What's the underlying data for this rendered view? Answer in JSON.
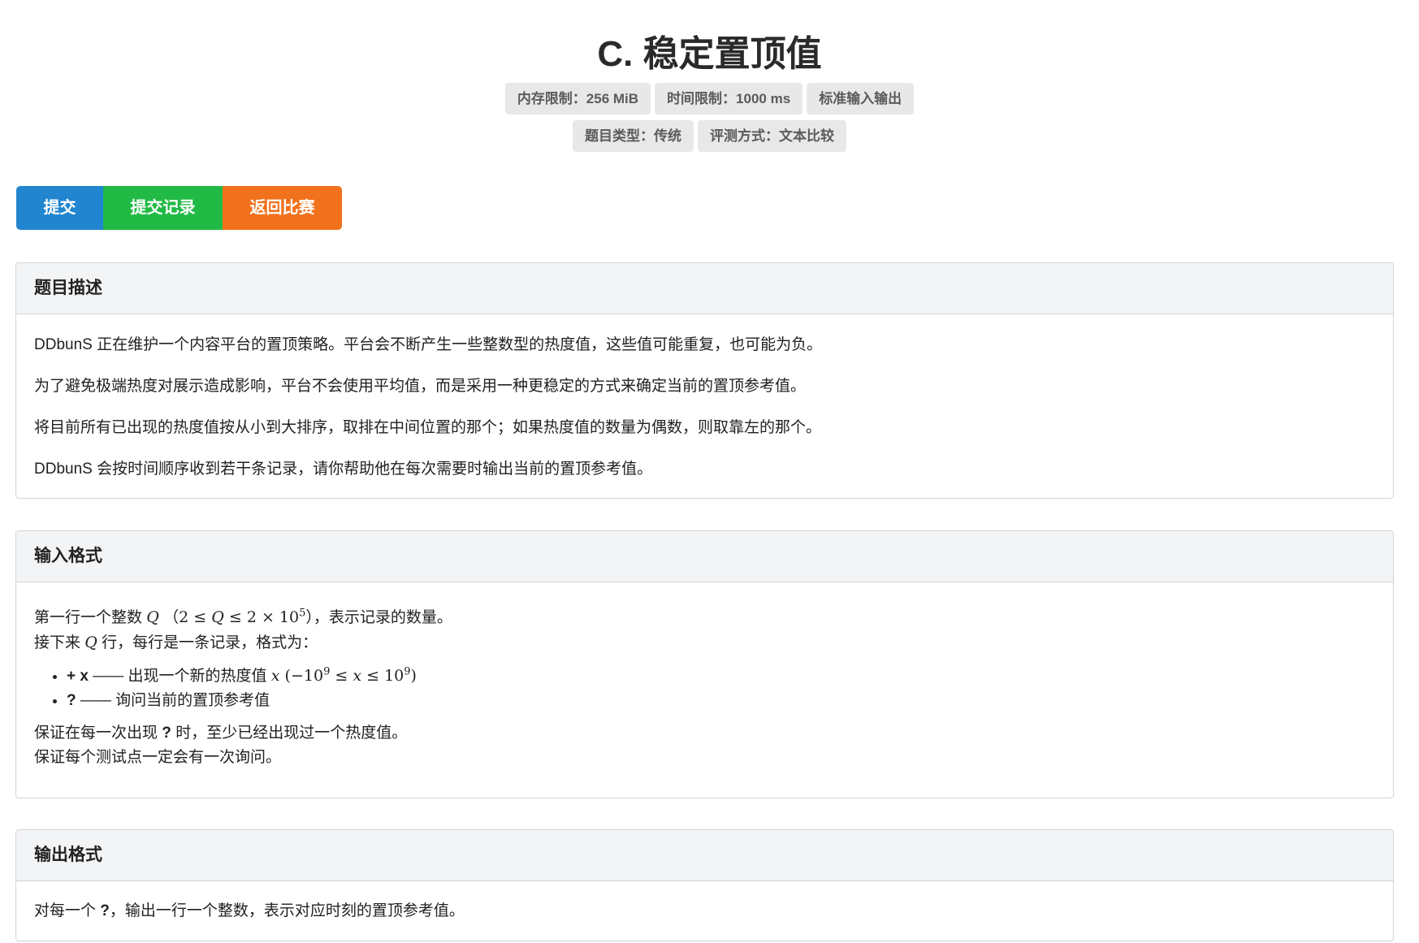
{
  "problem": {
    "title": "C. 稳定置顶值",
    "labels_row1": [
      "内存限制：256 MiB",
      "时间限制：1000 ms",
      "标准输入输出"
    ],
    "labels_row2": [
      "题目类型：传统",
      "评测方式：文本比较"
    ]
  },
  "actions": {
    "submit": "提交",
    "records": "提交记录",
    "back": "返回比赛"
  },
  "description": {
    "heading": "题目描述",
    "paragraphs": [
      "DDbunS 正在维护一个内容平台的置顶策略。平台会不断产生一些整数型的热度值，这些值可能重复，也可能为负。",
      "为了避免极端热度对展示造成影响，平台不会使用平均值，而是采用一种更稳定的方式来确定当前的置顶参考值。",
      "将目前所有已出现的热度值按从小到大排序，取排在中间位置的那个；如果热度值的数量为偶数，则取靠左的那个。",
      "DDbunS 会按时间顺序收到若干条记录，请你帮助他在每次需要时输出当前的置顶参考值。"
    ]
  },
  "input_format": {
    "heading": "输入格式",
    "line1_prefix": "第一行一个整数",
    "line1_var": "Q",
    "line1_constraint_open": "（",
    "line1_constraint_a": "2 ≤ ",
    "line1_constraint_var": "Q",
    "line1_constraint_b": " ≤ 2 × 10",
    "line1_constraint_exp": "5",
    "line1_constraint_close": "）",
    "line1_suffix": "，表示记录的数量。",
    "line2_prefix": "接下来",
    "line2_var": "Q",
    "line2_suffix": "行，每行是一条记录，格式为：",
    "item1_op": "+ x",
    "item1_text": "—— 出现一个新的热度值",
    "item1_var": "x",
    "item1_range_open": " (−10",
    "item1_range_exp1": "9",
    "item1_range_mid": " ≤ ",
    "item1_range_var": "x",
    "item1_range_mid2": " ≤ 10",
    "item1_range_exp2": "9",
    "item1_range_close": ")",
    "item2_op": "?",
    "item2_text": "—— 询问当前的置顶参考值",
    "guarantee1_prefix": "保证在每一次出现",
    "guarantee1_op": "?",
    "guarantee1_suffix": "时，至少已经出现过一个热度值。",
    "guarantee2": "保证每个测试点一定会有一次询问。"
  },
  "output_format": {
    "heading": "输出格式",
    "prefix": "对每一个",
    "op": "?",
    "suffix": "，输出一行一个整数，表示对应时刻的置顶参考值。"
  }
}
